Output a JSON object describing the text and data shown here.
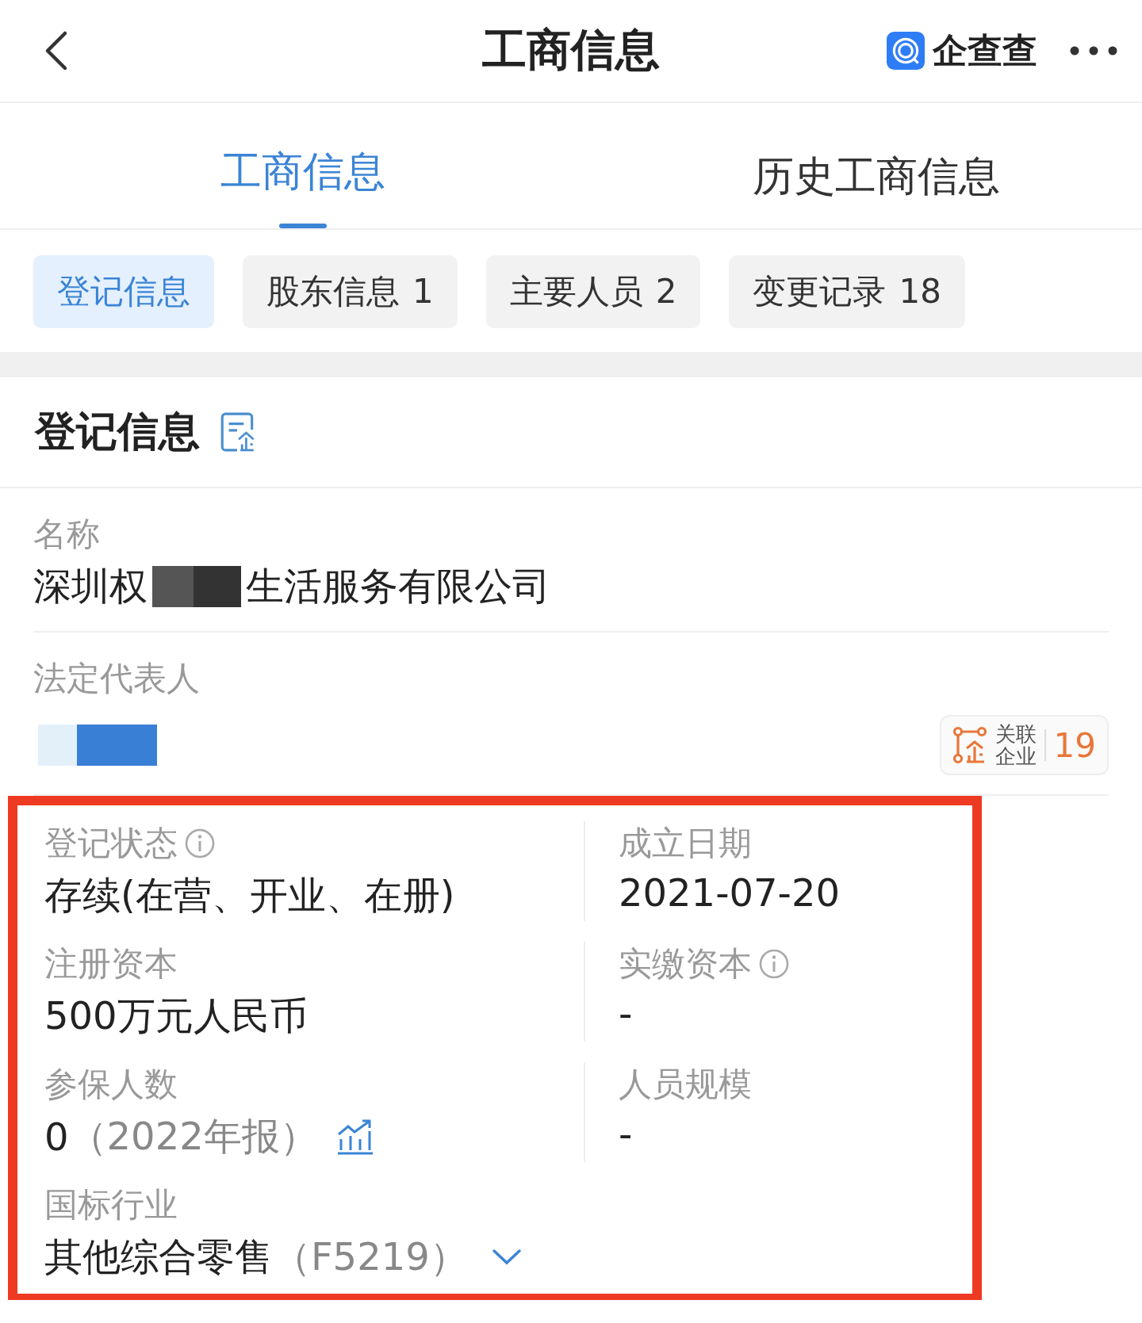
{
  "header": {
    "title": "工商信息",
    "brand": "企查查"
  },
  "tabs": [
    {
      "label": "工商信息",
      "selected": true
    },
    {
      "label": "历史工商信息",
      "selected": false
    }
  ],
  "chips": [
    {
      "label": "登记信息",
      "selected": true
    },
    {
      "label": "股东信息",
      "count": "1",
      "selected": false
    },
    {
      "label": "主要人员",
      "count": "2",
      "selected": false
    },
    {
      "label": "变更记录",
      "count": "18",
      "selected": false
    }
  ],
  "section": {
    "title": "登记信息"
  },
  "name": {
    "label": "名称",
    "value_start": "深圳权",
    "value_end": "生活服务有限公司"
  },
  "legal_rep": {
    "label": "法定代表人",
    "related": {
      "label_line1": "关联",
      "label_line2": "企业",
      "count": "19"
    }
  },
  "details": {
    "highlighted": true,
    "fields": [
      {
        "label": "登记状态",
        "info": true,
        "value": "存续(在营、开业、在册)"
      },
      {
        "label": "成立日期",
        "info": false,
        "value": "2021-07-20"
      },
      {
        "label": "注册资本",
        "info": false,
        "value": "500万元人民币"
      },
      {
        "label": "实缴资本",
        "info": true,
        "value": "-"
      },
      {
        "label": "参保人数",
        "info": false,
        "value": "0",
        "note": "（2022年报）",
        "kind": "chart"
      },
      {
        "label": "人员规模",
        "info": false,
        "value": "-"
      },
      {
        "label": "国标行业",
        "info": false,
        "value": "其他综合零售",
        "note": "（F5219）",
        "kind": "expand"
      }
    ]
  }
}
